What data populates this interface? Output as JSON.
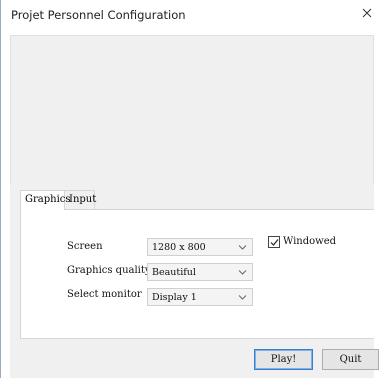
{
  "window": {
    "title": "Projet Personnel Configuration",
    "close_icon": "close-icon"
  },
  "tabs": [
    {
      "label": "Graphics",
      "active": true
    },
    {
      "label": "Input",
      "active": false
    }
  ],
  "graphics": {
    "screen": {
      "label": "Screen",
      "value": "1280 x 800"
    },
    "quality": {
      "label": "Graphics quality",
      "value": "Beautiful"
    },
    "monitor": {
      "label": "Select monitor",
      "value": "Display 1"
    },
    "windowed": {
      "label": "Windowed",
      "checked": true
    }
  },
  "buttons": {
    "play": "Play!",
    "quit": "Quit"
  },
  "colors": {
    "accent_border": "#3c7fd1",
    "panel_bg": "#f0f0f0"
  }
}
